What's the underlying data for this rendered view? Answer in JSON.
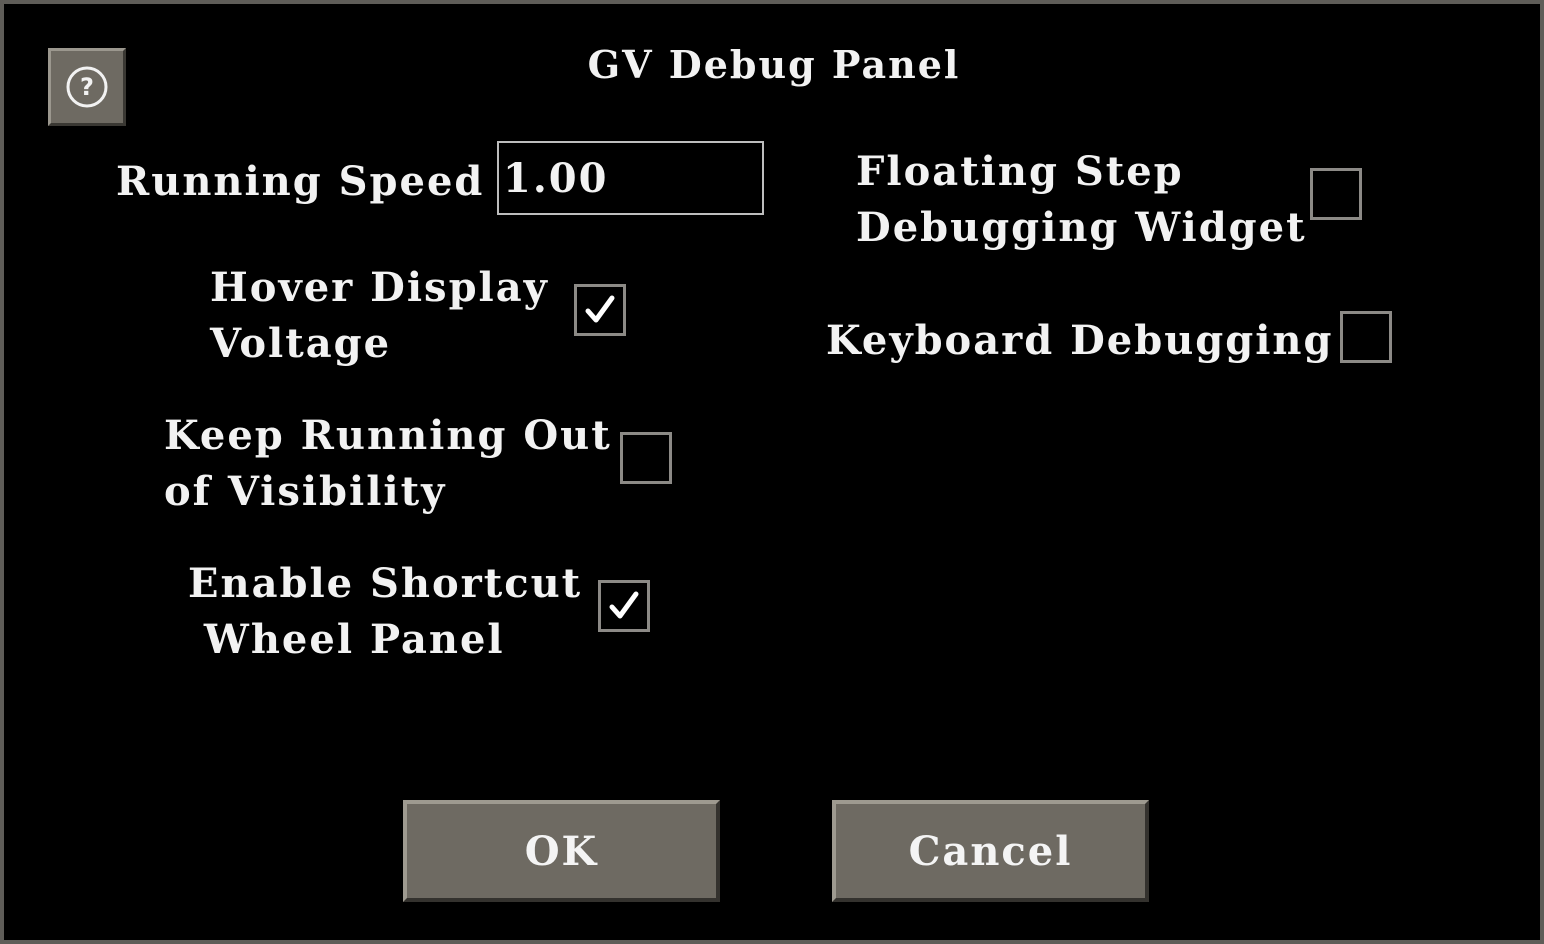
{
  "dialog": {
    "title": "GV Debug Panel"
  },
  "help": {
    "icon": "question-circle-icon"
  },
  "running_speed": {
    "label": "Running Speed",
    "value": "1.00"
  },
  "options": {
    "hover_display_voltage": {
      "label_line1": "Hover Display",
      "label_line2": "Voltage",
      "checked": true
    },
    "keep_running_out_of_visibility": {
      "label_line1": "Keep Running Out",
      "label_line2": "of Visibility",
      "checked": false
    },
    "enable_shortcut_wheel_panel": {
      "label_line1": "Enable Shortcut",
      "label_line2": " Wheel Panel",
      "checked": true
    },
    "floating_step_debugging_widget": {
      "label_line1": "Floating Step",
      "label_line2": "Debugging Widget",
      "checked": false
    },
    "keyboard_debugging": {
      "label": "Keyboard Debugging",
      "checked": false
    }
  },
  "buttons": {
    "ok_label": "OK",
    "cancel_label": "Cancel"
  },
  "colors": {
    "background": "#000000",
    "button_face": "#6e6a62",
    "text": "#f2f2f2",
    "checkbox_border": "#8c8a86"
  }
}
